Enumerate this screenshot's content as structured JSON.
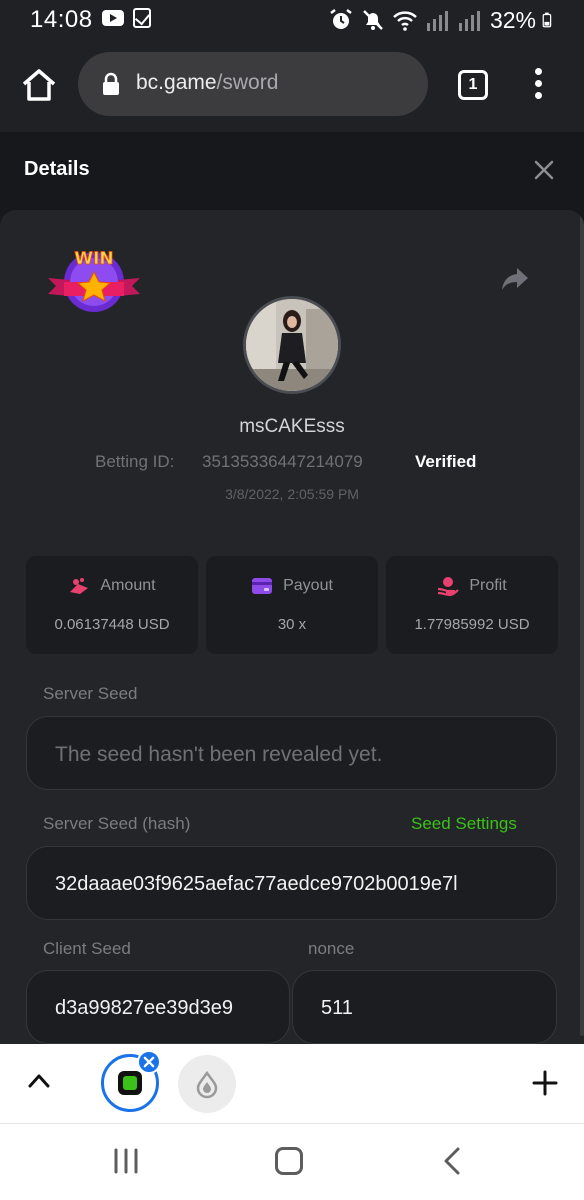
{
  "status_bar": {
    "time": "14:08",
    "battery": "32%",
    "icons": [
      "youtube-icon",
      "checkbox-icon",
      "alarm-icon",
      "mute-icon",
      "wifi-icon",
      "signal-icon",
      "signal-icon",
      "battery-icon"
    ]
  },
  "browser": {
    "url_host": "bc.game",
    "url_path": "/sword",
    "tab_count": "1"
  },
  "header": {
    "title": "Details"
  },
  "bet": {
    "username": "msCAKEsss",
    "betting_id_label": "Betting ID:",
    "betting_id": "35135336447214079",
    "verified": "Verified",
    "date": "3/8/2022, 2:05:59 PM",
    "badge_text": "WIN"
  },
  "stats": [
    {
      "label": "Amount",
      "value": "0.06137448 USD",
      "icon": "coins-icon",
      "color": "#e8416f"
    },
    {
      "label": "Payout",
      "value": "30 x",
      "icon": "card-icon",
      "color": "#8e4bea"
    },
    {
      "label": "Profit",
      "value": "1.77985992 USD",
      "icon": "profit-hand-icon",
      "color": "#e8416f"
    }
  ],
  "seeds": {
    "server_seed_label": "Server Seed",
    "server_seed_value": "The seed hasn't been revealed yet.",
    "server_seed_hash_label": "Server Seed (hash)",
    "seed_settings_link": "Seed Settings",
    "server_seed_hash_value": "32daaae03f9625aefac77aedce9702b0019e7l",
    "client_seed_label": "Client Seed",
    "client_seed_value": "d3a99827ee39d3e9",
    "nonce_label": "nonce",
    "nonce_value": "511"
  },
  "colors": {
    "accent_green": "#3bc117",
    "tab_blue": "#1a73e8",
    "card_bg": "#232528",
    "page_bg": "#17181b"
  }
}
